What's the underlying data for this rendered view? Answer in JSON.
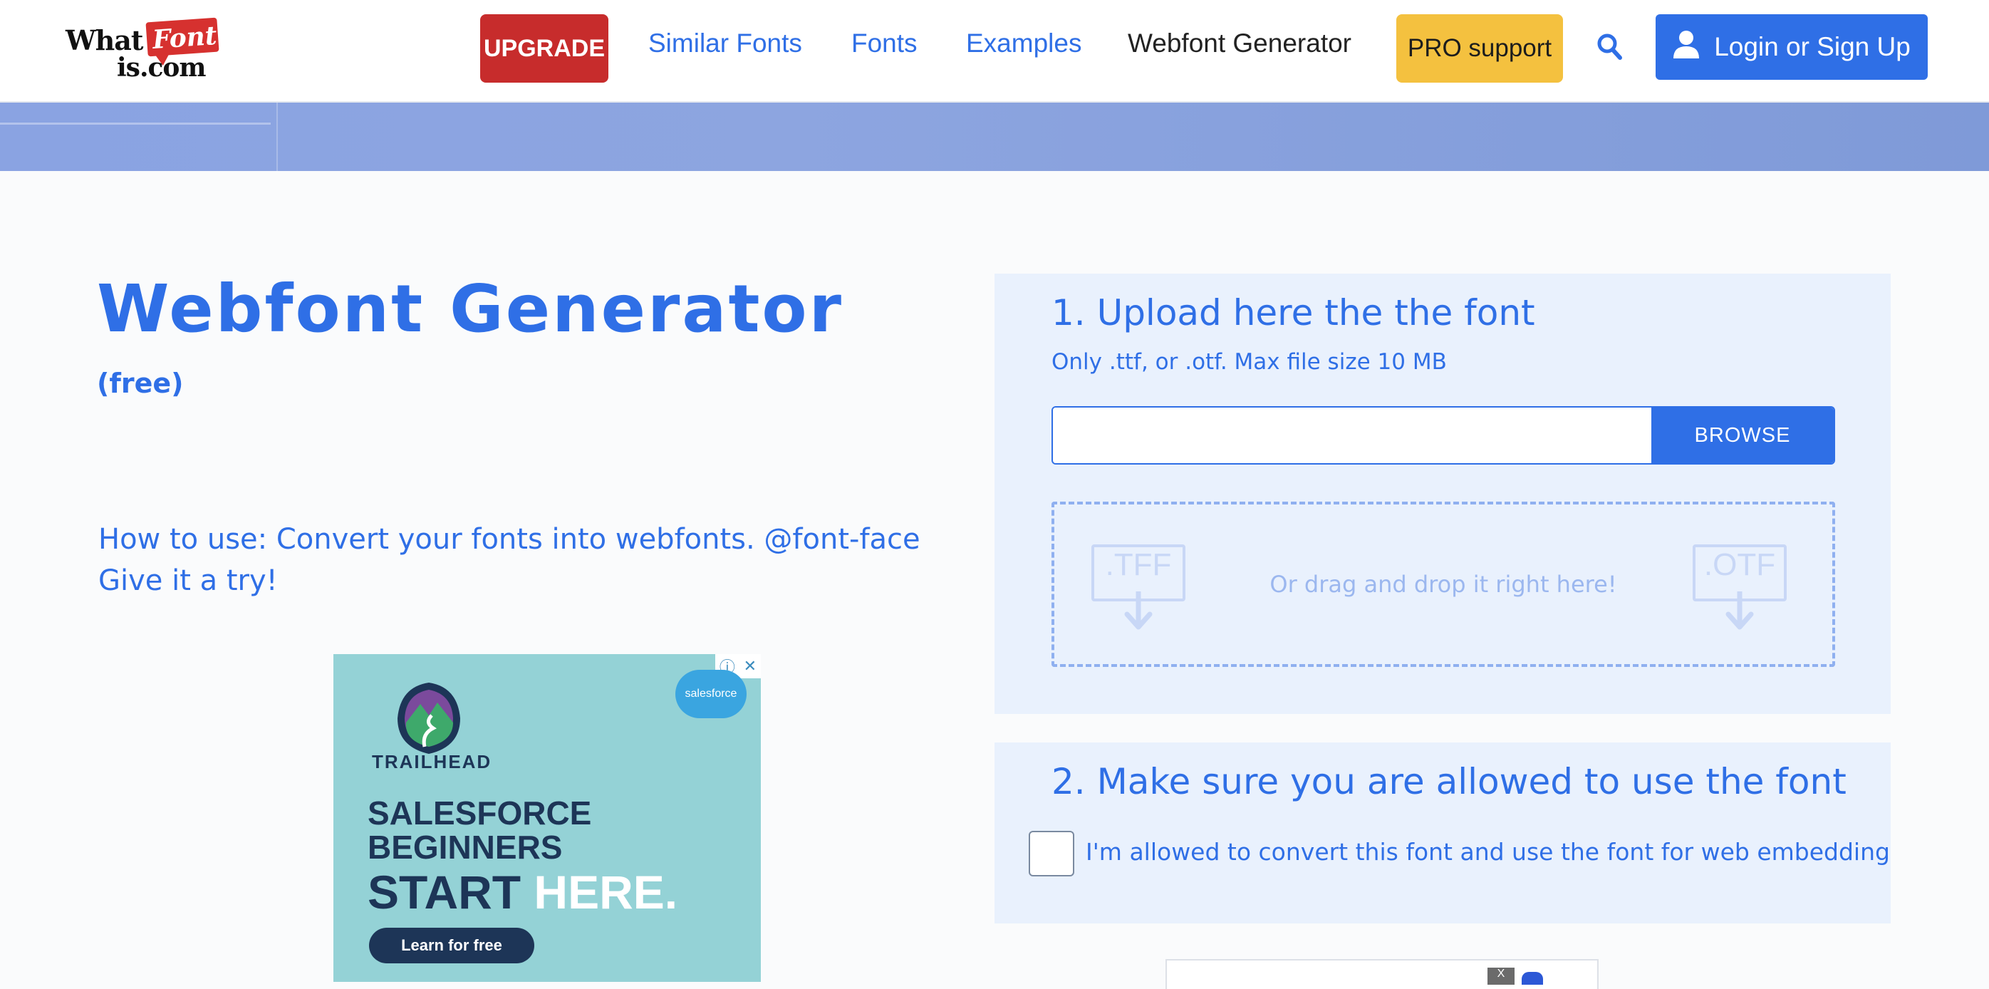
{
  "header": {
    "logo": {
      "what": "What",
      "font": "Font",
      "is": "is.com"
    },
    "upgrade_label": "UPGRADE",
    "nav": [
      {
        "label": "Similar Fonts"
      },
      {
        "label": "Fonts"
      },
      {
        "label": "Examples"
      },
      {
        "label": "Webfont Generator"
      }
    ],
    "pro_label": "PRO support",
    "login_label": "Login or Sign Up",
    "icons": {
      "search": "search-icon",
      "user": "user-icon"
    }
  },
  "main": {
    "title": "Webfont Generator",
    "subtitle": "(free)",
    "howto_line1": "How to use: Convert your fonts into webfonts. @font-face",
    "howto_line2": "Give it a try!"
  },
  "ad": {
    "brand": "salesforce",
    "trailhead": "TRAILHEAD",
    "line1": "SALESFORCE",
    "line2": "BEGINNERS",
    "line3a": "START ",
    "line3b": "HERE.",
    "cta": "Learn for free",
    "info": "ⓘ",
    "close": "✕"
  },
  "upload": {
    "title": "1. Upload here the the font",
    "subtitle": "Only .ttf, or .otf. Max file size 10 MB",
    "input_value": "",
    "browse_label": "BROWSE",
    "drop_text": "Or drag and drop it right here!",
    "tff_label": ".TFF",
    "otf_label": ".OTF"
  },
  "permission": {
    "title": "2. Make sure you are allowed to use the font",
    "checkbox_label": "I'm allowed to convert this font and use the font for web embedding",
    "checked": false
  },
  "ad2": {
    "close": "X"
  },
  "colors": {
    "accent": "#2f6fe6",
    "upgrade": "#c72c2c",
    "pro": "#f4c13f",
    "panel": "#e9f1fd"
  }
}
